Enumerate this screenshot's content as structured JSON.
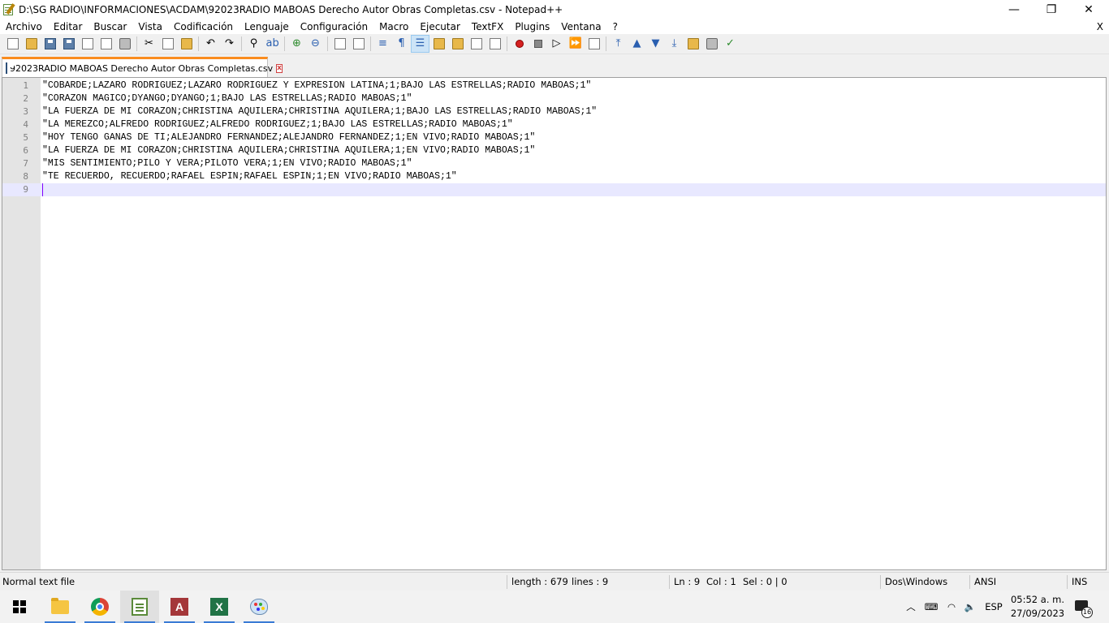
{
  "window": {
    "title": "D:\\SG RADIO\\INFORMACIONES\\ACDAM\\92023RADIO MABOAS Derecho Autor Obras Completas.csv - Notepad++",
    "minimize": "—",
    "maximize": "❐",
    "close": "✕"
  },
  "menu": {
    "items": [
      "Archivo",
      "Editar",
      "Buscar",
      "Vista",
      "Codificación",
      "Lenguaje",
      "Configuración",
      "Macro",
      "Ejecutar",
      "TextFX",
      "Plugins",
      "Ventana",
      "?"
    ],
    "close_doc": "X"
  },
  "tab": {
    "label": "92023RADIO MABOAS Derecho Autor Obras Completas.csv",
    "close": "x"
  },
  "editor": {
    "lines": [
      "\"COBARDE;LAZARO RODRIGUEZ;LAZARO RODRIGUEZ Y EXPRESION LATINA;1;BAJO LAS ESTRELLAS;RADIO MABOAS;1\"",
      "\"CORAZON MAGICO;DYANGO;DYANGO;1;BAJO LAS ESTRELLAS;RADIO MABOAS;1\"",
      "\"LA FUERZA DE MI CORAZON;CHRISTINA AQUILERA;CHRISTINA AQUILERA;1;BAJO LAS ESTRELLAS;RADIO MABOAS;1\"",
      "\"LA MEREZCO;ALFREDO RODRIGUEZ;ALFREDO RODRIGUEZ;1;BAJO LAS ESTRELLAS;RADIO MABOAS;1\"",
      "\"HOY TENGO GANAS DE TI;ALEJANDRO FERNANDEZ;ALEJANDRO FERNANDEZ;1;EN VIVO;RADIO MABOAS;1\"",
      "\"LA FUERZA DE MI CORAZON;CHRISTINA AQUILERA;CHRISTINA AQUILERA;1;EN VIVO;RADIO MABOAS;1\"",
      "\"MIS SENTIMIENTO;PILO Y VERA;PILOTO VERA;1;EN VIVO;RADIO MABOAS;1\"",
      "\"TE RECUERDO, RECUERDO;RAFAEL ESPIN;RAFAEL ESPIN;1;EN VIVO;RADIO MABOAS;1\"",
      ""
    ],
    "line_numbers": [
      "1",
      "2",
      "3",
      "4",
      "5",
      "6",
      "7",
      "8",
      "9"
    ],
    "current_line": 9
  },
  "status": {
    "file_type": "Normal text file",
    "length": "length : 679",
    "lines": "lines : 9",
    "ln": "Ln : 9",
    "col": "Col : 1",
    "sel": "Sel : 0 | 0",
    "eol": "Dos\\Windows",
    "encoding": "ANSI",
    "mode": "INS"
  },
  "taskbar": {
    "language": "ESP",
    "time": "05:52 a. m.",
    "date": "27/09/2023",
    "notifications": "16"
  },
  "colors": {
    "tab_accent": "#fa8c1e",
    "current_line_bg": "#e8e8ff",
    "gutter_bg": "#e4e4e4",
    "taskbar_accent": "#3a7bd5"
  }
}
